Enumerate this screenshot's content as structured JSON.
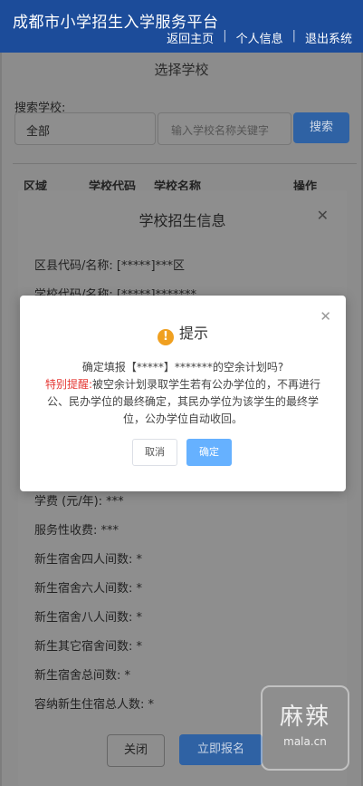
{
  "header": {
    "title": "成都市小学招生入学服务平台",
    "nav": [
      "返回主页",
      "个人信息",
      "退出系统"
    ],
    "nav_sep": "|"
  },
  "school_select": {
    "title": "选择学校",
    "search_label": "搜索学校:",
    "district_value": "全部",
    "search_placeholder": "输入学校名称关键字",
    "search_button": "搜索",
    "columns": [
      "区域",
      "学校代码",
      "学校名称",
      "操作"
    ]
  },
  "school_info": {
    "title": "学校招生信息",
    "close_icon": "close-icon",
    "fields": [
      "区县代码/名称: [*****]***区",
      "学校代码/名称: [*****]*******",
      "学费 (元/年): ***",
      "服务性收费: ***",
      "新生宿舍四人间数: *",
      "新生宿舍六人间数: *",
      "新生宿舍八人间数: *",
      "新生其它宿舍间数: *",
      "新生宿舍总间数: *",
      "容纳新生住宿总人数: *"
    ],
    "close_button": "关闭",
    "apply_button": "立即报名"
  },
  "dialog": {
    "title": "提示",
    "icon": "warning-icon",
    "question": "确定填报【*****】*******的空余计划吗?",
    "warning_label": "特别提醒:",
    "warning_text": "被空余计划录取学生若有公办学位的，不再进行公、民办学位的最终确定，其民办学位为该学生的最终学位，公办学位自动收回。",
    "cancel": "取消",
    "confirm": "确定"
  },
  "watermark": {
    "text": "麻辣",
    "site": "mala.cn"
  }
}
